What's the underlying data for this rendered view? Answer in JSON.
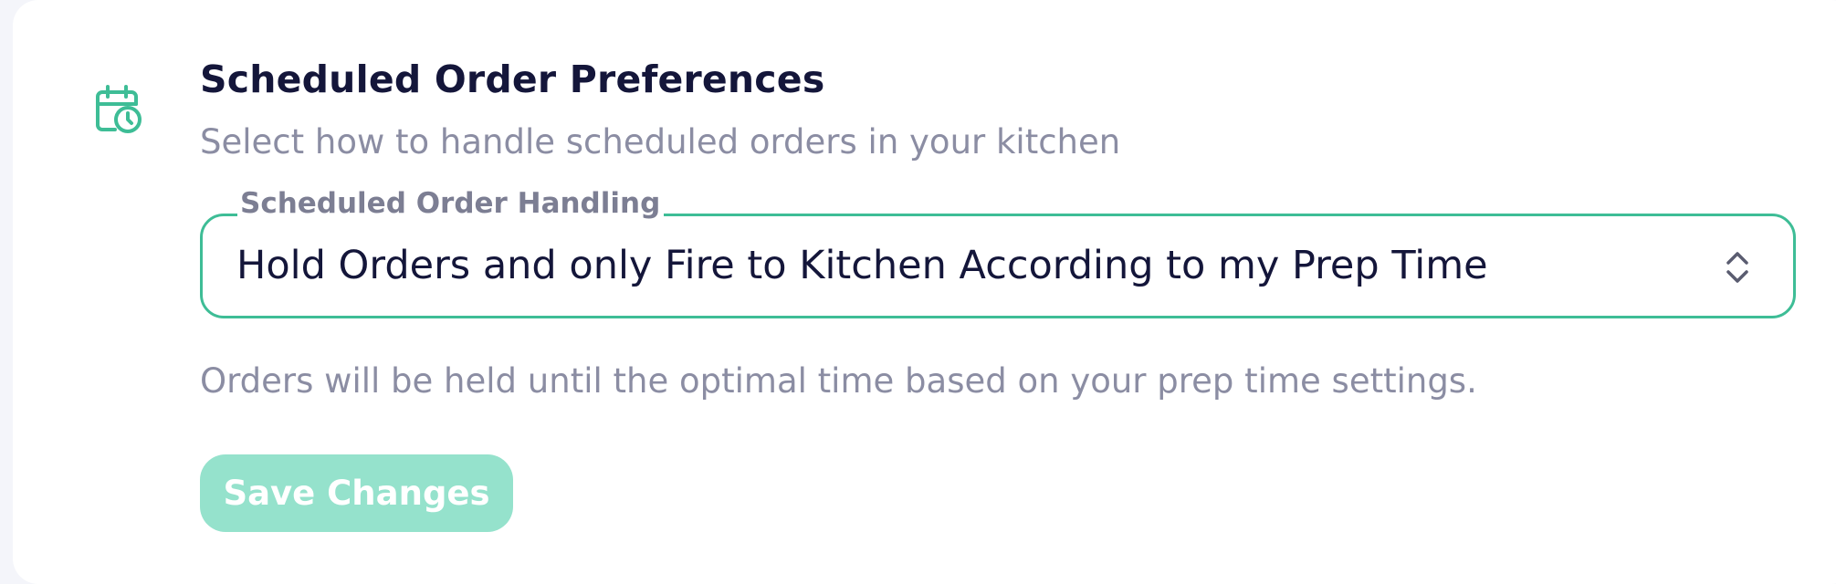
{
  "section": {
    "icon": "calendar-clock-icon",
    "title": "Scheduled Order Preferences",
    "subtitle": "Select how to handle scheduled orders in your kitchen"
  },
  "select": {
    "label": "Scheduled Order Handling",
    "value": "Hold Orders and only Fire to Kitchen According to my Prep Time",
    "icon": "chevron-up-down-icon",
    "helper": "Orders will be held until the optimal time based on your prep time settings."
  },
  "actions": {
    "save_label": "Save Changes"
  },
  "colors": {
    "accent": "#3ebd96",
    "button_disabled": "#95e2cc",
    "title": "#14163a",
    "muted": "#8b8da3"
  }
}
